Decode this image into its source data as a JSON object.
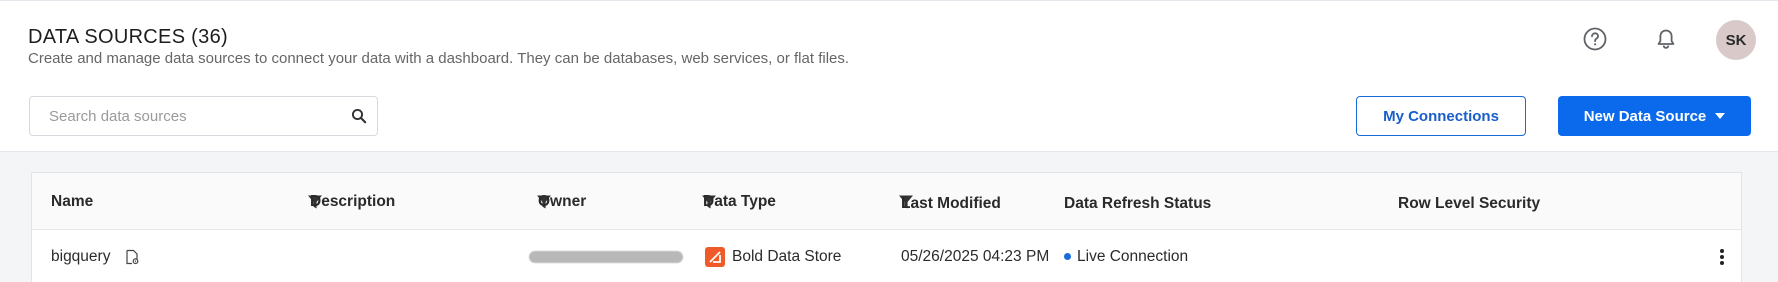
{
  "header": {
    "title": "DATA SOURCES (36)",
    "subtitle": "Create and manage data sources to connect your data with a dashboard. They can be databases, web services, or flat files.",
    "avatar_initials": "SK",
    "icons": [
      "help-icon",
      "bell-icon"
    ]
  },
  "search": {
    "placeholder": "Search data sources",
    "value": ""
  },
  "actions": {
    "my_connections": "My Connections",
    "new_data_source": "New Data Source"
  },
  "grid": {
    "columns": {
      "name": "Name",
      "description": "Description",
      "owner": "Owner",
      "data_type": "Data Type",
      "last_modified": "Last Modified",
      "refresh_status": "Data Refresh Status",
      "row_security": "Row Level Security"
    },
    "rows": [
      {
        "name": "bigquery",
        "description": "",
        "owner": "(redacted)",
        "data_type": "Bold Data Store",
        "last_modified": "05/26/2025 04:23 PM",
        "refresh_status": "Live Connection",
        "row_security": ""
      }
    ]
  },
  "colors": {
    "accent": "#0a6aeb",
    "status_dot": "#1a6cd9",
    "bold_data_store": "#f05a28",
    "avatar_bg": "#d9c9c9"
  }
}
